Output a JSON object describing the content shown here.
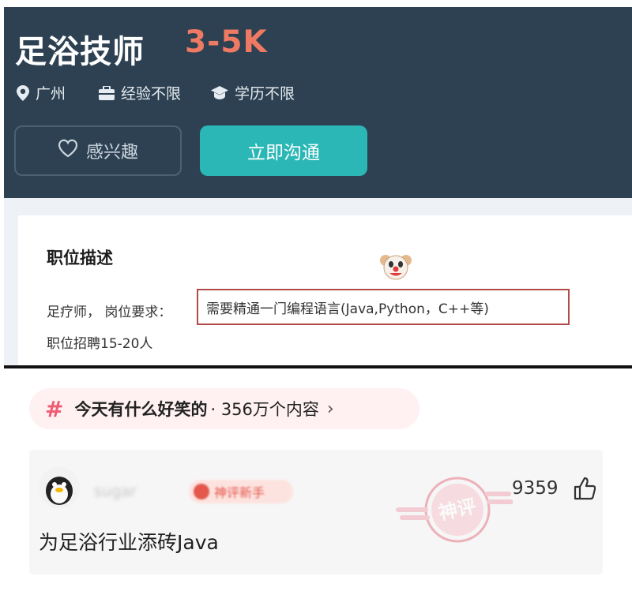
{
  "job": {
    "title": "足浴技师",
    "salary": "3-5K",
    "location": "广州",
    "experience": "经验不限",
    "education": "学历不限",
    "interest_button": "感兴趣",
    "chat_button": "立即沟通"
  },
  "description": {
    "heading": "职位描述",
    "requirement_prefix": "足疗师，  岗位要求：",
    "requirement_highlight": "需要精通一门编程语言(Java,Python，C++等)",
    "recruit_count": "职位招聘15-20人"
  },
  "topic": {
    "hash": "#",
    "name": "今天有什么好笑的",
    "count": "· 356万个内容",
    "arrow": "›"
  },
  "comment": {
    "username": "sugar",
    "badge": "神评新手",
    "stamp_text": "神评",
    "likes": "9359",
    "text": "为足浴行业添砖Java"
  },
  "colors": {
    "header_bg": "#2d4152",
    "salary": "#ef7a63",
    "chat_button": "#2ab7b5",
    "highlight_border": "#b24a4a",
    "topic_accent": "#f05b72"
  },
  "icons": [
    "location-pin-icon",
    "briefcase-icon",
    "graduation-cap-icon",
    "heart-icon",
    "clown-emoji-icon",
    "thumbs-up-icon"
  ]
}
